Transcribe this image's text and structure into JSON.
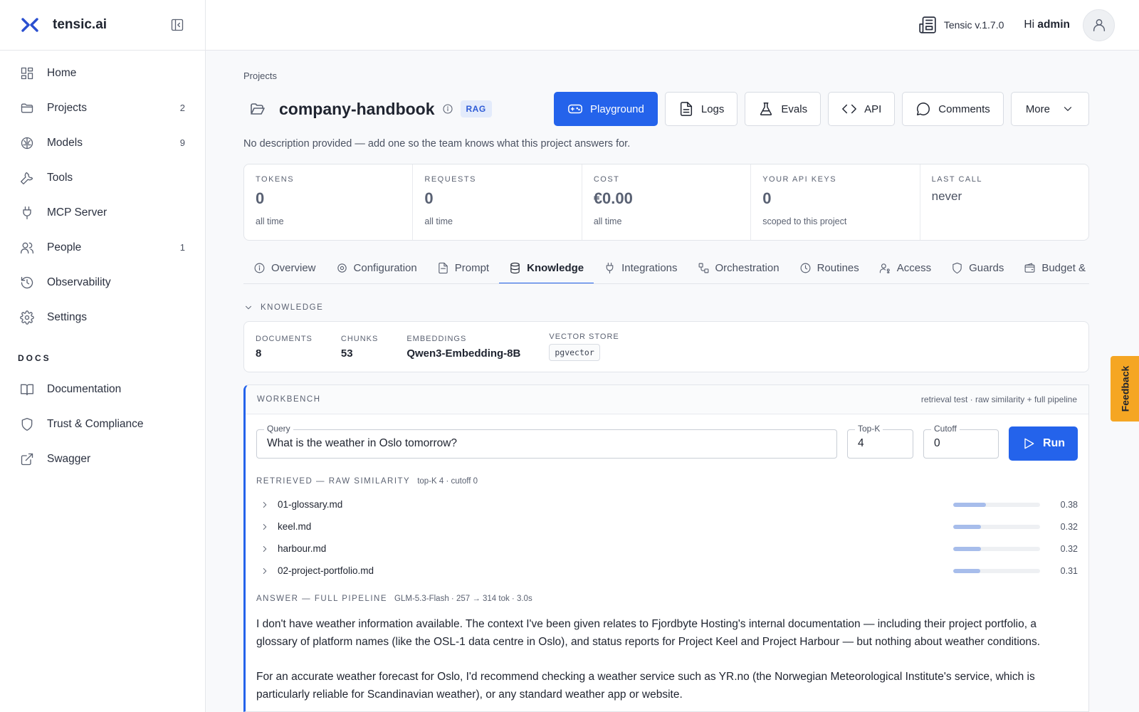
{
  "app": {
    "brand": "tensic.ai",
    "version": "Tensic v.1.7.0",
    "greeting_prefix": "Hi",
    "user": "admin"
  },
  "sidebar": {
    "items": [
      {
        "label": "Home",
        "icon": "dashboard-icon",
        "count": ""
      },
      {
        "label": "Projects",
        "icon": "folder-icon",
        "count": "2"
      },
      {
        "label": "Models",
        "icon": "brain-icon",
        "count": "9"
      },
      {
        "label": "Tools",
        "icon": "wrench-icon",
        "count": ""
      },
      {
        "label": "MCP Server",
        "icon": "plug-icon",
        "count": ""
      },
      {
        "label": "People",
        "icon": "users-icon",
        "count": "1"
      },
      {
        "label": "Observability",
        "icon": "history-icon",
        "count": ""
      },
      {
        "label": "Settings",
        "icon": "gear-icon",
        "count": ""
      }
    ],
    "docs_title": "DOCS",
    "docs": [
      {
        "label": "Documentation",
        "icon": "book-icon"
      },
      {
        "label": "Trust & Compliance",
        "icon": "shield-icon"
      },
      {
        "label": "Swagger",
        "icon": "external-link-icon"
      }
    ]
  },
  "page": {
    "breadcrumb": "Projects",
    "title": "company-handbook",
    "badge": "RAG",
    "description": "No description provided — add one so the team knows what this project answers for.",
    "actions": {
      "playground": "Playground",
      "logs": "Logs",
      "evals": "Evals",
      "api": "API",
      "comments": "Comments",
      "more": "More"
    }
  },
  "stats": [
    {
      "label": "TOKENS",
      "value": "0",
      "sub": "all time"
    },
    {
      "label": "REQUESTS",
      "value": "0",
      "sub": "all time"
    },
    {
      "label": "COST",
      "value": "€0.00",
      "sub": "all time"
    },
    {
      "label": "YOUR API KEYS",
      "value": "0",
      "sub": "scoped to this project"
    },
    {
      "label": "LAST CALL",
      "value": "never",
      "sub": ""
    }
  ],
  "tabs": [
    {
      "label": "Overview",
      "icon": "info-icon",
      "active": false
    },
    {
      "label": "Configuration",
      "icon": "gear-icon",
      "active": false
    },
    {
      "label": "Prompt",
      "icon": "document-icon",
      "active": false
    },
    {
      "label": "Knowledge",
      "icon": "database-icon",
      "active": true
    },
    {
      "label": "Integrations",
      "icon": "plug-icon",
      "active": false
    },
    {
      "label": "Orchestration",
      "icon": "workflow-icon",
      "active": false
    },
    {
      "label": "Routines",
      "icon": "clock-icon",
      "active": false
    },
    {
      "label": "Access",
      "icon": "user-key-icon",
      "active": false
    },
    {
      "label": "Guards",
      "icon": "shield-icon",
      "active": false
    },
    {
      "label": "Budget & Lim",
      "icon": "wallet-icon",
      "active": false
    }
  ],
  "knowledge": {
    "section_label": "KNOWLEDGE",
    "documents_label": "DOCUMENTS",
    "documents": "8",
    "chunks_label": "CHUNKS",
    "chunks": "53",
    "embeddings_label": "EMBEDDINGS",
    "embeddings": "Qwen3-Embedding-8B",
    "vector_label": "VECTOR STORE",
    "vector": "pgvector"
  },
  "workbench": {
    "title": "WORKBENCH",
    "note": "retrieval test · raw similarity + full pipeline",
    "query_label": "Query",
    "query": "What is the weather in Oslo tomorrow?",
    "topk_label": "Top-K",
    "topk": "4",
    "cutoff_label": "Cutoff",
    "cutoff": "0",
    "run": "Run",
    "retrieved_title": "RETRIEVED — RAW SIMILARITY",
    "retrieved_meta": "top-K 4 · cutoff 0",
    "results": [
      {
        "name": "01-glossary.md",
        "score": "0.38",
        "value": 0.38
      },
      {
        "name": "keel.md",
        "score": "0.32",
        "value": 0.32
      },
      {
        "name": "harbour.md",
        "score": "0.32",
        "value": 0.32
      },
      {
        "name": "02-project-portfolio.md",
        "score": "0.31",
        "value": 0.31
      }
    ],
    "answer_title": "ANSWER — FULL PIPELINE",
    "answer_meta": "GLM-5.3-Flash · 257 → 314 tok · 3.0s",
    "answer_p1": "I don't have weather information available. The context I've been given relates to Fjordbyte Hosting's internal documentation — including their project portfolio, a glossary of platform names (like the OSL-1 data centre in Oslo), and status reports for Project Keel and Project Harbour — but nothing about weather conditions.",
    "answer_p2": "For an accurate weather forecast for Oslo, I'd recommend checking a weather service such as YR.no (the Norwegian Meteorological Institute's service, which is particularly reliable for Scandinavian weather), or any standard weather app or website."
  },
  "feedback": "Feedback",
  "colors": {
    "accent": "#2463eb",
    "feedback": "#f5a623",
    "bar": "#a7bdeb"
  }
}
